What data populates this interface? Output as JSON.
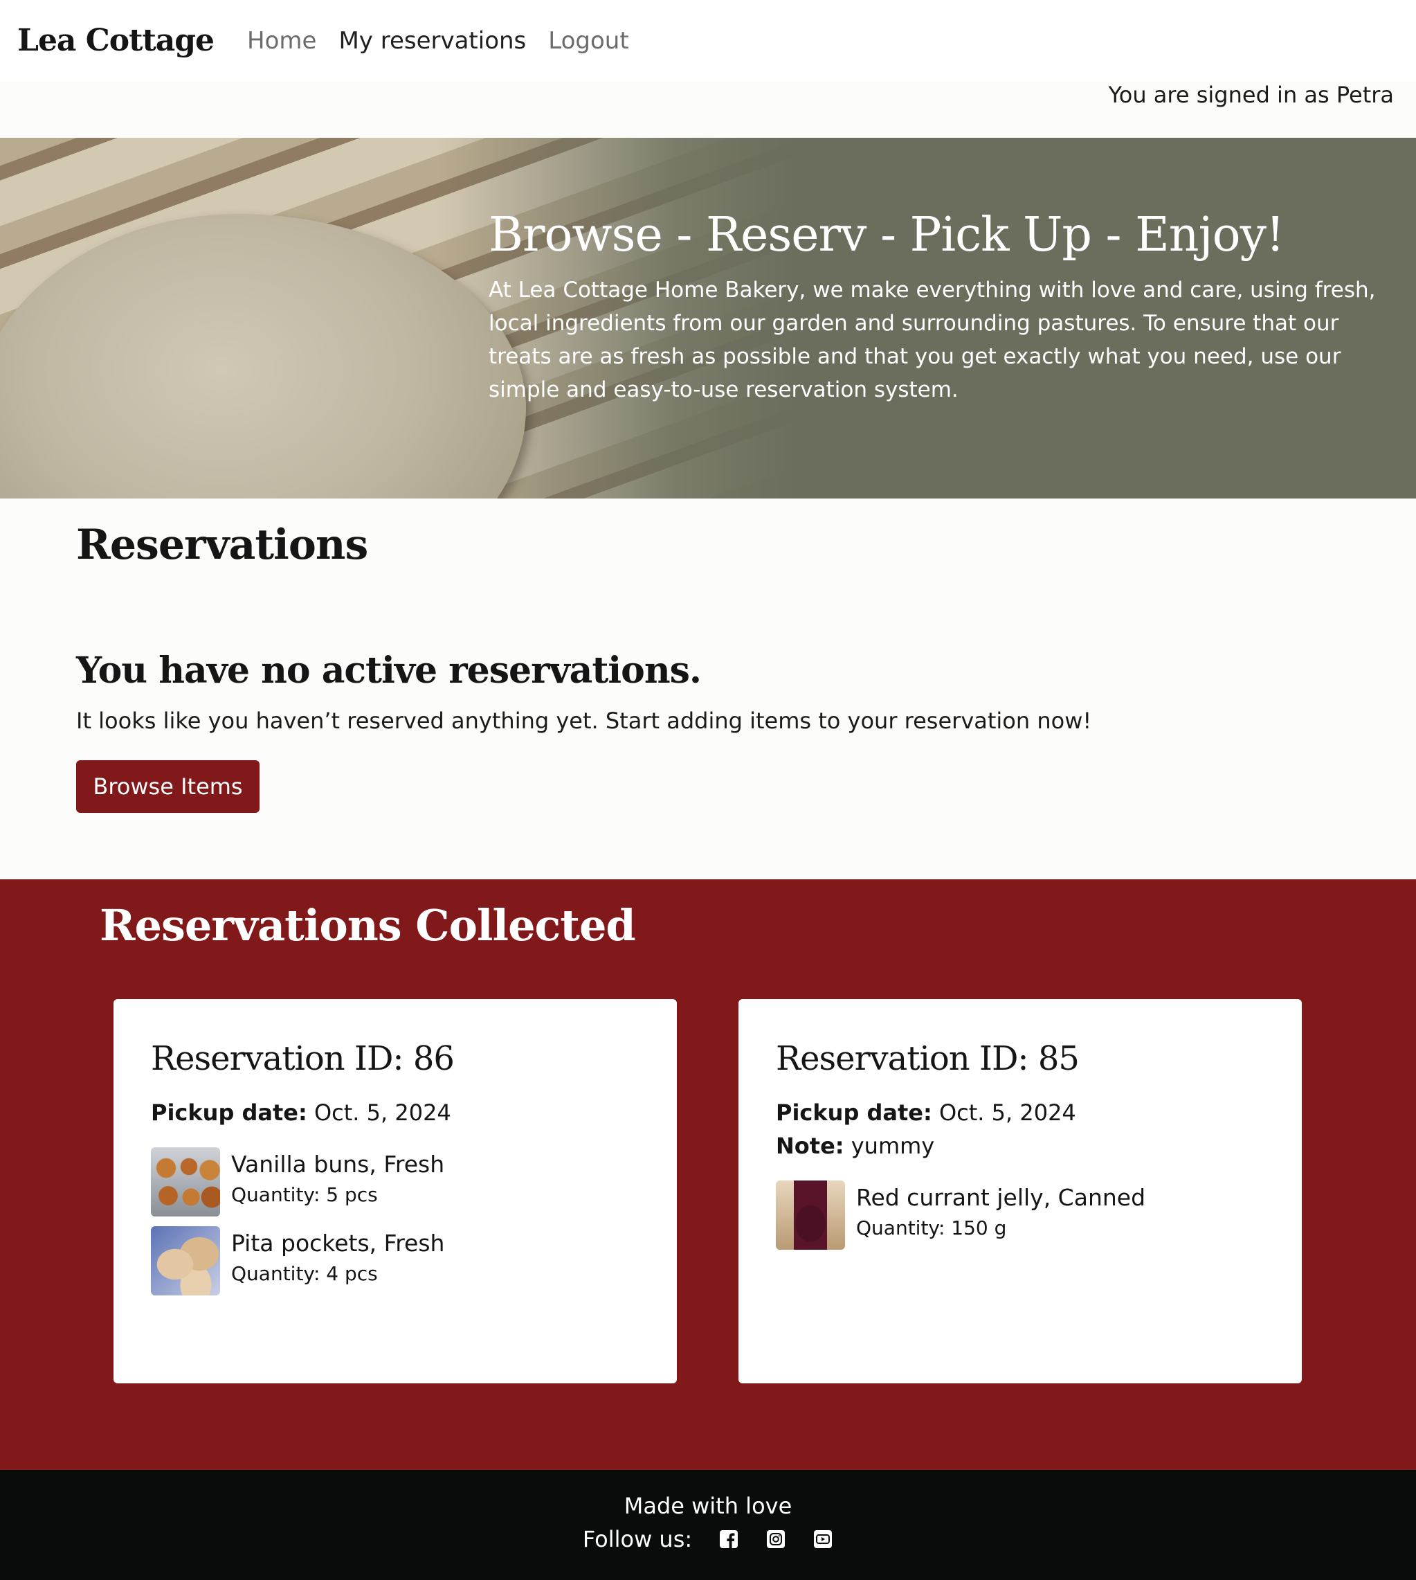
{
  "nav": {
    "brand": "Lea Cottage",
    "links": [
      "Home",
      "My reservations",
      "Logout"
    ]
  },
  "signed_in": "You are signed in as Petra",
  "hero": {
    "title": "Browse - Reserv - Pick Up - Enjoy!",
    "description": "At Lea Cottage Home Bakery, we make everything with love and care, using fresh, local ingredients from our garden and surrounding pastures. To ensure that our treats are as fresh as possible and that you get exactly what you need, use our simple and easy-to-use reservation system."
  },
  "reservations": {
    "title": "Reservations",
    "empty_heading": "You have no active reservations.",
    "empty_message": "It looks like you haven’t reserved anything yet. Start adding items to your reservation now!",
    "browse_button": "Browse Items"
  },
  "collected": {
    "title": "Reservations Collected",
    "cards": [
      {
        "title": "Reservation ID: 86",
        "pickup_label": "Pickup date:",
        "pickup_value": "Oct. 5, 2024",
        "items": [
          {
            "name": "Vanilla buns, Fresh",
            "qty": "Quantity: 5 pcs"
          },
          {
            "name": "Pita pockets, Fresh",
            "qty": "Quantity: 4 pcs"
          }
        ]
      },
      {
        "title": "Reservation ID: 85",
        "pickup_label": "Pickup date:",
        "pickup_value": "Oct. 5, 2024",
        "note_label": "Note:",
        "note_value": "yummy",
        "items": [
          {
            "name": "Red currant jelly, Canned",
            "qty": "Quantity: 150 g"
          }
        ]
      }
    ]
  },
  "footer": {
    "made": "Made with love",
    "follow": "Follow us:",
    "social_icons": [
      "facebook-icon",
      "instagram-icon",
      "youtube-icon"
    ]
  },
  "colors": {
    "brand_red": "#81191a",
    "hero_olive": "#6b6e5d",
    "footer_black": "#0a0b0b"
  }
}
